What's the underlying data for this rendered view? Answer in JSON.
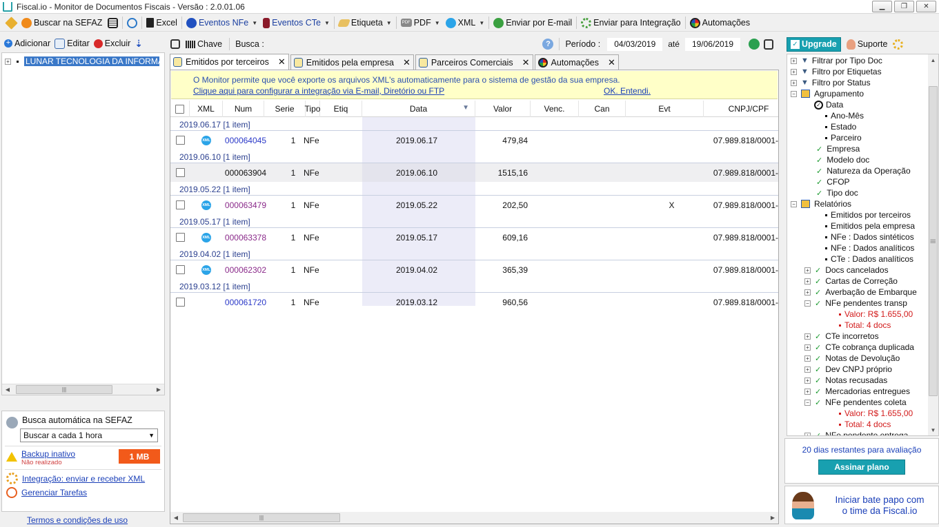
{
  "window": {
    "title": "Fiscal.io - Monitor de Documentos Fiscais - Versão : 2.0.01.06"
  },
  "toolbar": {
    "buscar_sefaz": "Buscar na SEFAZ",
    "excel": "Excel",
    "eventos_nfe": "Eventos NFe",
    "eventos_cte": "Eventos CTe",
    "etiqueta": "Etiqueta",
    "pdf": "PDF",
    "xml": "XML",
    "enviar_email": "Enviar por E-mail",
    "enviar_integracao": "Enviar para Integração",
    "automacoes": "Automações"
  },
  "left": {
    "adicionar": "Adicionar",
    "editar": "Editar",
    "excluir": "Excluir",
    "company": "LUNAR TECNOLOGIA DA INFORMA",
    "busca_auto_label": "Busca automática na SEFAZ",
    "busca_auto_value": "Buscar a cada 1 hora",
    "backup_label": "Backup inativo",
    "backup_sub": "Não realizado",
    "backup_size": "1 MB",
    "integracao": "Integração: enviar e receber XML",
    "gerenciar": "Gerenciar Tarefas",
    "termos": "Termos e condições de uso"
  },
  "filter": {
    "chave": "Chave",
    "busca": "Busca :",
    "periodo": "Período :",
    "date_from": "04/03/2019",
    "ate": "até",
    "date_to": "19/06/2019"
  },
  "tabs": [
    {
      "label": "Emitidos por terceiros"
    },
    {
      "label": "Emitidos pela empresa"
    },
    {
      "label": "Parceiros Comerciais"
    },
    {
      "label": "Automações"
    }
  ],
  "banner": {
    "message": "O Monitor permite que você exporte os arquivos XML's automaticamente para o sistema de gestão da sua empresa.",
    "config_link": "Clique aqui para configurar a integração via E-mail, Diretório ou FTP",
    "ok_link": "OK. Entendi."
  },
  "grid": {
    "columns": [
      "XML",
      "Num",
      "Serie",
      "Tipo",
      "Etiq",
      "Data",
      "Valor",
      "Venc.",
      "Can",
      "Evt",
      "CNPJ/CPF"
    ],
    "groups": [
      {
        "label": "2019.06.17 [1 item]",
        "row": {
          "xml": true,
          "num": "000064045",
          "serie": "1",
          "tipo": "NFe",
          "data": "2019.06.17",
          "valor": "479,84",
          "evt": "",
          "cnpj": "07.989.818/0001-",
          "color": "blue"
        }
      },
      {
        "label": "2019.06.10 [1 item]",
        "row": {
          "xml": false,
          "num": "000063904",
          "serie": "1",
          "tipo": "NFe",
          "data": "2019.06.10",
          "valor": "1515,16",
          "evt": "",
          "cnpj": "07.989.818/0001-",
          "color": "black"
        }
      },
      {
        "label": "2019.05.22 [1 item]",
        "row": {
          "xml": true,
          "num": "000063479",
          "serie": "1",
          "tipo": "NFe",
          "data": "2019.05.22",
          "valor": "202,50",
          "evt": "X",
          "cnpj": "07.989.818/0001-",
          "color": "purple"
        }
      },
      {
        "label": "2019.05.17 [1 item]",
        "row": {
          "xml": true,
          "num": "000063378",
          "serie": "1",
          "tipo": "NFe",
          "data": "2019.05.17",
          "valor": "609,16",
          "evt": "",
          "cnpj": "07.989.818/0001-",
          "color": "purple"
        }
      },
      {
        "label": "2019.04.02 [1 item]",
        "row": {
          "xml": true,
          "num": "000062302",
          "serie": "1",
          "tipo": "NFe",
          "data": "2019.04.02",
          "valor": "365,39",
          "evt": "",
          "cnpj": "07.989.818/0001-",
          "color": "purple"
        }
      },
      {
        "label": "2019.03.12 [1 item]",
        "row": {
          "xml": false,
          "num": "000061720",
          "serie": "1",
          "tipo": "NFe",
          "data": "2019.03.12",
          "valor": "960,56",
          "evt": "",
          "cnpj": "07.989.818/0001-",
          "color": "blue"
        }
      }
    ],
    "xml_badge": "XML"
  },
  "right": {
    "upgrade": "Upgrade",
    "suporte": "Suporte",
    "tree": [
      {
        "label": "Filtrar por Tipo Doc",
        "kind": "filter",
        "level": 0
      },
      {
        "label": "Filtro por Etiquetas",
        "kind": "filter",
        "level": 0
      },
      {
        "label": "Filtro por Status",
        "kind": "filter",
        "level": 0
      },
      {
        "label": "Agrupamento",
        "kind": "folder",
        "level": 0
      },
      {
        "label": "Data",
        "kind": "radio",
        "level": 1
      },
      {
        "label": "Ano-Mês",
        "kind": "bullet",
        "level": 1
      },
      {
        "label": "Estado",
        "kind": "bullet",
        "level": 1
      },
      {
        "label": "Parceiro",
        "kind": "bullet",
        "level": 1
      },
      {
        "label": "Empresa",
        "kind": "check",
        "level": 1
      },
      {
        "label": "Modelo doc",
        "kind": "check",
        "level": 1
      },
      {
        "label": "Natureza da Operação",
        "kind": "check",
        "level": 1
      },
      {
        "label": "CFOP",
        "kind": "check",
        "level": 1
      },
      {
        "label": "Tipo doc",
        "kind": "check",
        "level": 1
      },
      {
        "label": "Relatórios",
        "kind": "folder",
        "level": 0
      },
      {
        "label": "Emitidos por terceiros",
        "kind": "bullet",
        "level": 1
      },
      {
        "label": "Emitidos pela empresa",
        "kind": "bullet",
        "level": 1
      },
      {
        "label": "NFe : Dados sintéticos",
        "kind": "bullet",
        "level": 1
      },
      {
        "label": "NFe : Dados analíticos",
        "kind": "bullet",
        "level": 1
      },
      {
        "label": "CTe : Dados analíticos",
        "kind": "bullet",
        "level": 1
      },
      {
        "label": "Docs cancelados",
        "kind": "pcheck",
        "level": 1
      },
      {
        "label": "Cartas de Correção",
        "kind": "pcheck",
        "level": 1
      },
      {
        "label": "Averbação de Embarque",
        "kind": "pcheck",
        "level": 1
      },
      {
        "label": "NFe pendentes transp",
        "kind": "mcheck",
        "level": 1
      },
      {
        "label": "Valor: R$ 1.655,00",
        "kind": "redbullet",
        "level": 2
      },
      {
        "label": "Total: 4 docs",
        "kind": "redbullet",
        "level": 2
      },
      {
        "label": "CTe incorretos",
        "kind": "pcheck",
        "level": 1
      },
      {
        "label": "CTe cobrança duplicada",
        "kind": "pcheck",
        "level": 1
      },
      {
        "label": "Notas de Devolução",
        "kind": "pcheck",
        "level": 1
      },
      {
        "label": "Dev CNPJ próprio",
        "kind": "pcheck",
        "level": 1
      },
      {
        "label": "Notas recusadas",
        "kind": "pcheck",
        "level": 1
      },
      {
        "label": "Mercadorias entregues",
        "kind": "pcheck",
        "level": 1
      },
      {
        "label": "NFe pendentes coleta",
        "kind": "mcheck",
        "level": 1
      },
      {
        "label": "Valor: R$ 1.655,00",
        "kind": "redbullet",
        "level": 2
      },
      {
        "label": "Total: 4 docs",
        "kind": "redbullet",
        "level": 2
      },
      {
        "label": "NFe pendente entrega",
        "kind": "pcheck",
        "level": 1
      }
    ],
    "eval_text": "20 dias restantes para avaliação",
    "assinar": "Assinar plano",
    "chat_line1": "Iniciar bate papo com",
    "chat_line2": "o time da Fiscal.io"
  },
  "colors": {
    "accent": "#18a0b0",
    "selection": "#3a78c8",
    "banner": "#ffffc8",
    "link": "#1a3fb8",
    "alert": "#f25a1a"
  }
}
